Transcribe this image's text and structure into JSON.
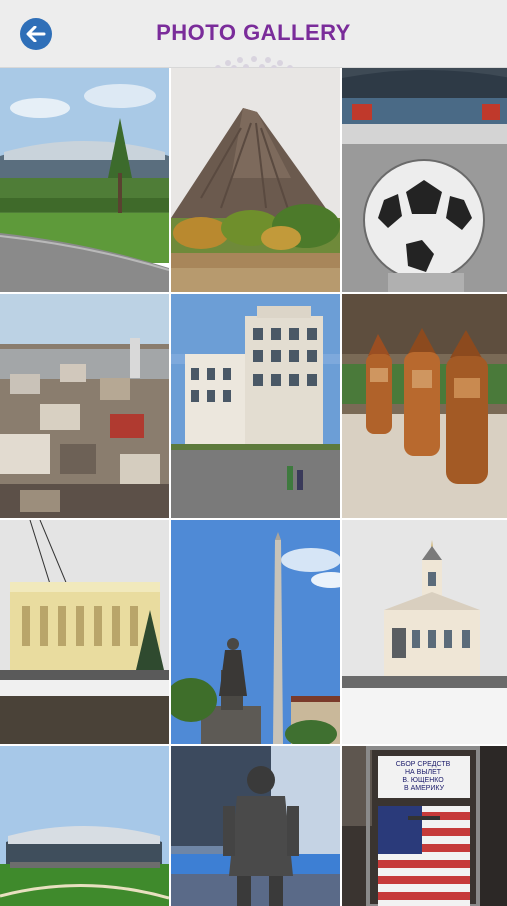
{
  "header": {
    "title": "PHOTO GALLERY",
    "back_icon": "back-arrow-icon",
    "accent_color": "#7a2c9a",
    "back_button_color": "#2f6fb8"
  },
  "gallery": {
    "photos": [
      {
        "id": "stadium-park"
      },
      {
        "id": "slag-heap-mountain"
      },
      {
        "id": "stone-football"
      },
      {
        "id": "city-aerial"
      },
      {
        "id": "hotel-building"
      },
      {
        "id": "wooden-gnome-statues"
      },
      {
        "id": "opera-theatre-winter"
      },
      {
        "id": "lenin-monument"
      },
      {
        "id": "cathedral-winter"
      },
      {
        "id": "arena-stadium"
      },
      {
        "id": "bronze-statue"
      },
      {
        "id": "fundraising-sign",
        "sign_text": "СБОР СРЕДСТВ НА ВЫЛЕТ В. ЮЩЕНКО В АМЕРИКУ"
      }
    ]
  }
}
